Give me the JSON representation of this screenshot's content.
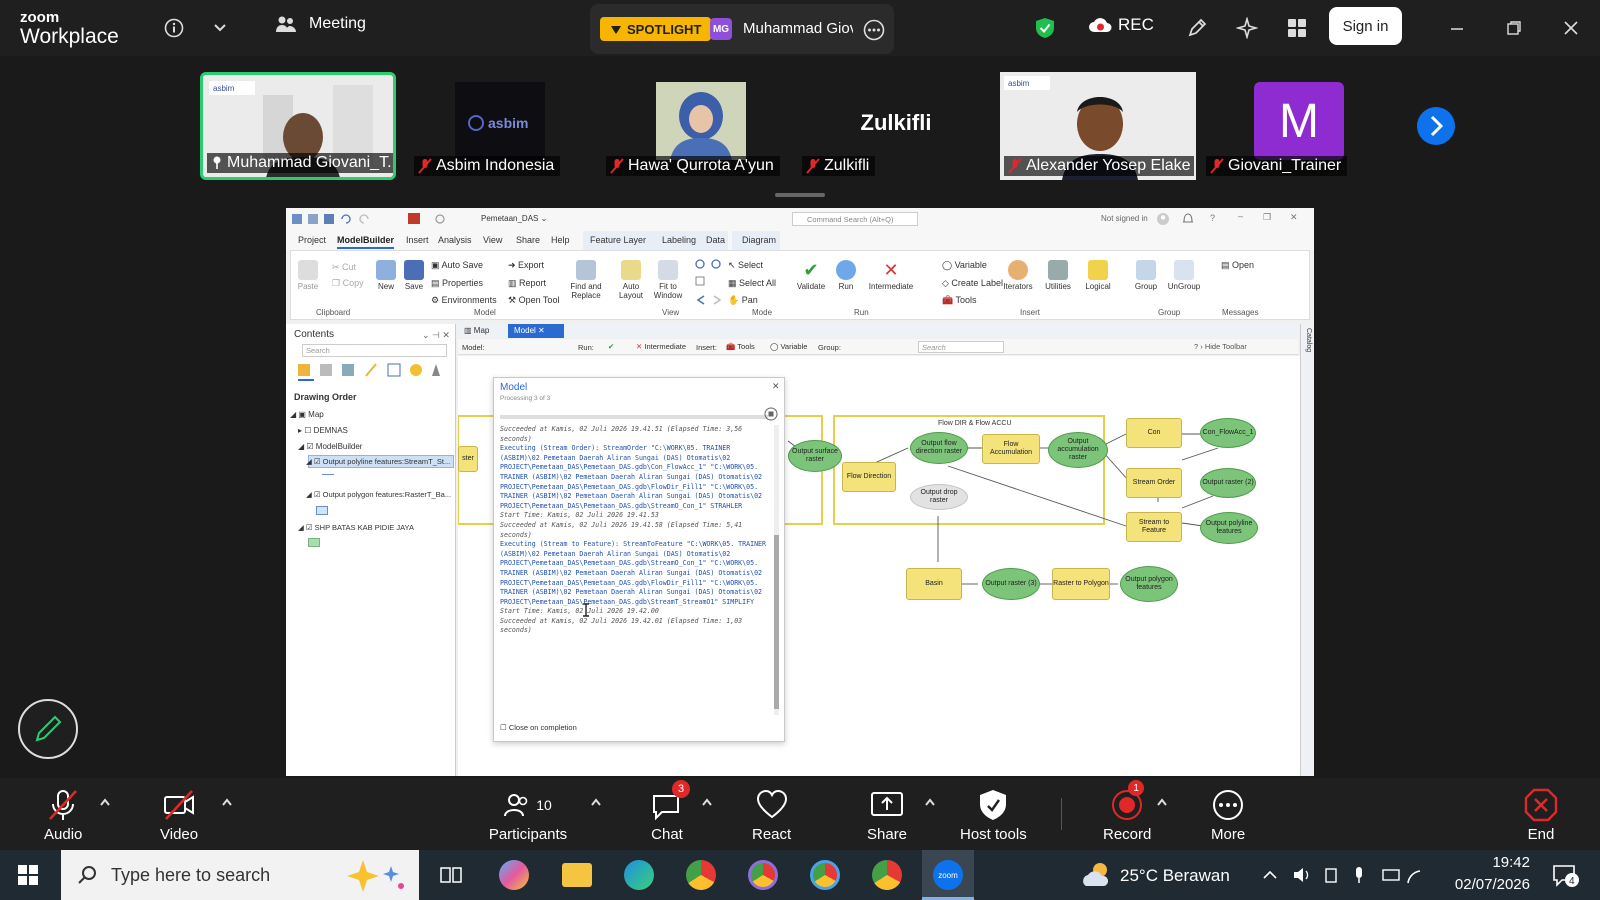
{
  "zoom": {
    "brand_line1": "zoom",
    "brand_line2": "Workplace",
    "meeting_label": "Meeting",
    "spotlight_label": "SPOTLIGHT",
    "spotlight_initials": "MG",
    "spotlight_name": "Muhammad Giov",
    "rec_label": "REC",
    "signin_label": "Sign in",
    "accent": "#0e72ed",
    "rec_color": "#e02828"
  },
  "participants": [
    {
      "name": "Muhammad Giovani_T...",
      "active": true
    },
    {
      "name": "Asbim Indonesia"
    },
    {
      "name": "Hawa' Qurrota A'yun"
    },
    {
      "name": "Zulkifli",
      "tile_text": "Zulkifli"
    },
    {
      "name": "Alexander Yosep Elake"
    },
    {
      "name": "Giovani_Trainer",
      "initial": "M",
      "color": "#8e2bd1"
    }
  ],
  "arcgis": {
    "quick": {
      "file": "Pemetaan_DAS ⌄",
      "command_search": "Command Search (Alt+Q)",
      "not_signed": "Not signed in"
    },
    "tabs": [
      "Project",
      "ModelBuilder",
      "Insert",
      "Analysis",
      "View",
      "Share",
      "Help"
    ],
    "context_tabs": [
      "Feature Layer",
      "Labeling",
      "Data",
      "Diagram"
    ],
    "ribbon": {
      "paste": "Paste",
      "cut": "Cut",
      "copy": "Copy",
      "new": "New",
      "save": "Save",
      "auto_save": "Auto Save",
      "properties": "Properties",
      "environments": "Environments",
      "export": "Export",
      "report": "Report",
      "open_tool": "Open Tool",
      "find_replace": "Find and\nReplace",
      "auto_layout": "Auto\nLayout",
      "fit_window": "Fit to\nWindow",
      "select": "Select",
      "select_all": "Select All",
      "pan": "Pan",
      "validate": "Validate",
      "run": "Run",
      "intermediate": "Intermediate",
      "variable": "Variable",
      "create_label": "Create Label",
      "tools": "Tools",
      "iterators": "Iterators",
      "utilities": "Utilities",
      "logical": "Logical",
      "group": "Group",
      "ungroup": "UnGroup",
      "open": "Open"
    },
    "groups": [
      "Clipboard",
      "Model",
      "View",
      "Mode",
      "Run",
      "Insert",
      "Group",
      "Messages"
    ],
    "contents": {
      "title": "Contents",
      "search_placeholder": "Search",
      "drawing_order": "Drawing Order",
      "layers": [
        "Map",
        "DEMNAS",
        "ModelBuilder",
        "Output polyline features:StreamT_St...",
        "Output polygon features:RasterT_Ba...",
        "SHP BATAS KAB PIDIE JAYA"
      ]
    },
    "view_tabs": [
      "Map",
      "Model"
    ],
    "model_toolbar": {
      "model": "Model:",
      "run": "Run:",
      "intermediate": "Intermediate",
      "insert": "Insert:",
      "tools": "Tools",
      "variable": "Variable",
      "group": "Group:",
      "search": "Search",
      "hide": "Hide Toolbar"
    },
    "catalog": "Catalog",
    "dialog": {
      "title": "Model",
      "subtitle": "Processing 3 of 3",
      "close_on_completion": "Close on completion",
      "log": [
        {
          "t": "s",
          "v": "Succeeded at Kamis, 02 Juli 2026 19.41.51 (Elapsed Time: 3,56 seconds)"
        },
        {
          "t": "k",
          "v": "Executing (Stream Order): StreamOrder \"C:\\WORK\\05. TRAINER (ASBIM)\\02 Pemetaan Daerah Aliran Sungai (DAS) Otomatis\\02 PROJECT\\Pemetaan_DAS\\Pemetaan_DAS.gdb\\Con_FlowAcc_1\" \"C:\\WORK\\05. TRAINER (ASBIM)\\02 Pemetaan Daerah Aliran Sungai (DAS) Otomatis\\02 PROJECT\\Pemetaan_DAS\\Pemetaan_DAS.gdb\\FlowDir_Fill1\" \"C:\\WORK\\05. TRAINER (ASBIM)\\02 Pemetaan Daerah Aliran Sungai (DAS) Otomatis\\02 PROJECT\\Pemetaan_DAS\\Pemetaan_DAS.gdb\\StreamO_Con_1\" STRAHLER"
        },
        {
          "t": "s",
          "v": "Start Time: Kamis, 02 Juli 2026 19.41.53"
        },
        {
          "t": "s",
          "v": "Succeeded at Kamis, 02 Juli 2026 19.41.58 (Elapsed Time: 5,41 seconds)"
        },
        {
          "t": "k",
          "v": "Executing (Stream to Feature): StreamToFeature \"C:\\WORK\\05. TRAINER (ASBIM)\\02 Pemetaan Daerah Aliran Sungai (DAS) Otomatis\\02 PROJECT\\Pemetaan_DAS\\Pemetaan_DAS.gdb\\StreamO_Con_1\" \"C:\\WORK\\05. TRAINER (ASBIM)\\02 Pemetaan Daerah Aliran Sungai (DAS) Otomatis\\02 PROJECT\\Pemetaan_DAS\\Pemetaan_DAS.gdb\\FlowDir_Fill1\" \"C:\\WORK\\05. TRAINER (ASBIM)\\02 Pemetaan Daerah Aliran Sungai (DAS) Otomatis\\02 PROJECT\\Pemetaan_DAS\\Pemetaan_DAS.gdb\\StreamT_StreamO1\" SIMPLIFY"
        },
        {
          "t": "s",
          "v": "Start Time: Kamis, 02 Juli 2026 19.42.00"
        },
        {
          "t": "s",
          "v": "Succeeded at Kamis, 02 Juli 2026 19.42.01 (Elapsed Time: 1,03 seconds)"
        }
      ]
    },
    "model": {
      "group_title": "Flow DIR & Flow ACCU",
      "nodes": {
        "ast": "ster",
        "osr": "Output surface\nraster",
        "fdir": "Flow Direction",
        "ofd": "Output flow\ndirection raster",
        "odr": "Output drop raster",
        "facc": "Flow\nAccumulation",
        "oacc": "Output\naccumulation\nraster",
        "con": "Con",
        "confa": "Con_FlowAcc_1",
        "so": "Stream Order",
        "or2": "Output raster (2)",
        "stf": "Stream to Feature",
        "opl": "Output polyline\nfeatures",
        "basin": "Basin",
        "or3": "Output raster (3)",
        "rtp": "Raster to Polygon",
        "opg": "Output polygon\nfeatures"
      }
    }
  },
  "bottombar": {
    "audio": "Audio",
    "video": "Video",
    "participants": "Participants",
    "participants_count": "10",
    "chat": "Chat",
    "chat_badge": "3",
    "react": "React",
    "share": "Share",
    "host_tools": "Host tools",
    "record": "Record",
    "record_badge": "1",
    "more": "More",
    "end": "End"
  },
  "taskbar": {
    "search_placeholder": "Type here to search",
    "weather": "25°C  Berawan",
    "time": "19:42",
    "date": "02/07/2026",
    "notif_count": "4"
  }
}
